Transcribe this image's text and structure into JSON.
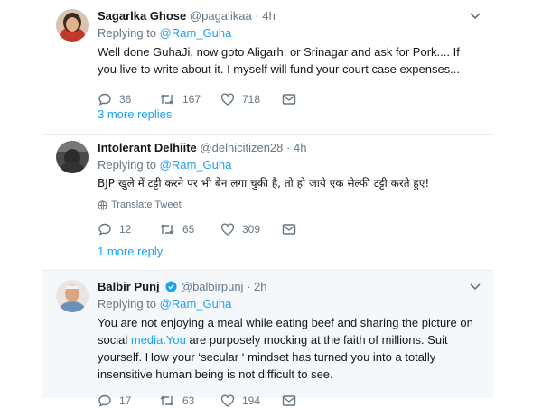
{
  "tweets": [
    {
      "name": "Sagarlka Ghose",
      "handle": "@pagalikaa",
      "dot": "·",
      "time": "4h",
      "replying_prefix": "Replying to",
      "replying_to": "@Ram_Guha",
      "text": "Well done GuhaJi, now goto Aligarh, or Srinagar and ask for Pork.... If you live to write about it. I myself will fund your court case expenses...",
      "replies": "36",
      "retweets": "167",
      "likes": "718",
      "more_replies": "3 more replies"
    },
    {
      "name": "Intolerant Delhiite",
      "handle": "@delhicitizen28",
      "dot": "·",
      "time": "4h",
      "replying_prefix": "Replying to",
      "replying_to": "@Ram_Guha",
      "text": "BJP खुले में टट्टी करने पर भी बेन लगा चुकी है, तो हो जाये एक सेल्फी टट्टी करते हुए!",
      "translate": "Translate Tweet",
      "replies": "12",
      "retweets": "65",
      "likes": "309",
      "more_replies": "1 more reply"
    },
    {
      "name": "Balbir Punj",
      "handle": "@balbirpunj",
      "dot": "·",
      "time": "2h",
      "replying_prefix": "Replying to",
      "replying_to": "@Ram_Guha",
      "text_before": "You are not enjoying a meal while eating beef and sharing the picture on social ",
      "text_link": "media.You",
      "text_after": " are purposely mocking at the faith of millions. Suit yourself. How your ‘secular ‘ mindset has turned you into a totally insensitive human being is not difficult to see.",
      "replies": "17",
      "retweets": "63",
      "likes": "194"
    }
  ],
  "colors": {
    "link": "#1da1f2",
    "muted": "#657786",
    "text": "#14171a",
    "highlight_bg": "#f5f8fa",
    "verified": "#1da1f2"
  }
}
